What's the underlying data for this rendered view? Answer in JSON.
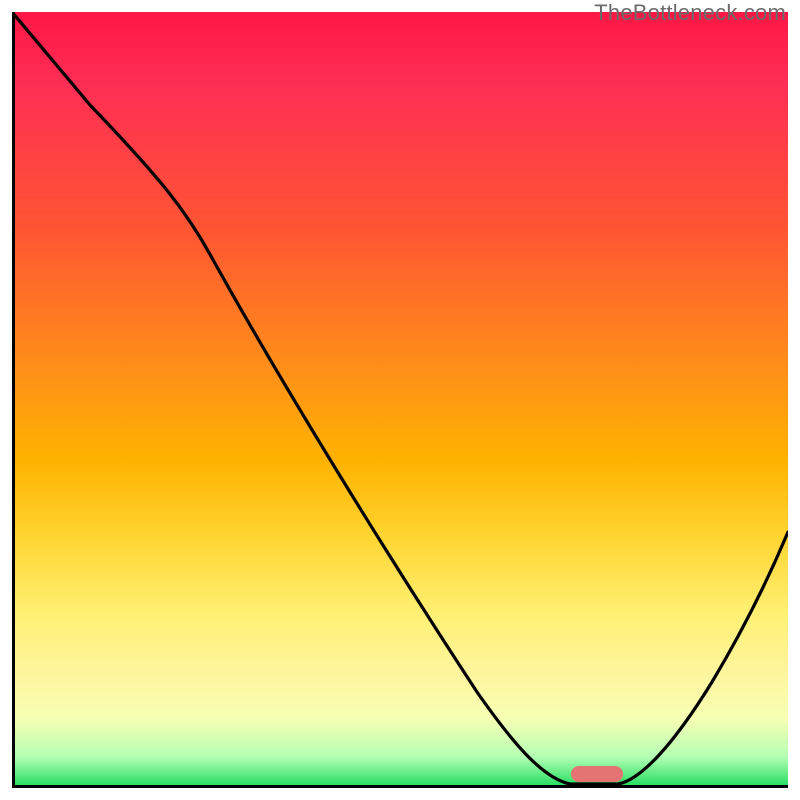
{
  "watermark": "TheBottleneck.com",
  "chart_data": {
    "type": "line",
    "title": "",
    "xlabel": "",
    "ylabel": "",
    "xlim": [
      0,
      100
    ],
    "ylim": [
      0,
      100
    ],
    "series": [
      {
        "name": "bottleneck-curve",
        "x": [
          0,
          10,
          22,
          30,
          40,
          50,
          60,
          66,
          70,
          74,
          78,
          80,
          84,
          88,
          92,
          96,
          100
        ],
        "values": [
          100,
          88,
          74,
          66,
          52,
          38,
          24,
          13,
          5,
          0,
          0,
          1,
          5,
          11,
          18,
          26,
          34
        ]
      }
    ],
    "optimal_marker": {
      "x_start": 72,
      "x_end": 79,
      "y": 0
    },
    "background_gradient": {
      "top": "#ff1744",
      "mid": "#ffd633",
      "bottom": "#1adb5c"
    }
  }
}
